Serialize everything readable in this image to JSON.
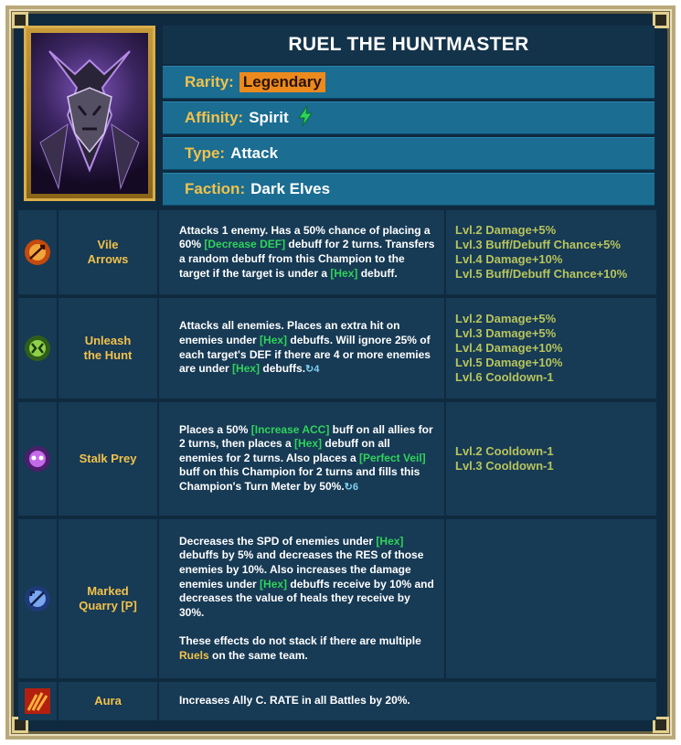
{
  "champion": {
    "name": "RUEL THE HUNTMASTER",
    "rarity_label": "Rarity:",
    "rarity": "Legendary",
    "affinity_label": "Affinity:",
    "affinity": "Spirit",
    "type_label": "Type:",
    "type": "Attack",
    "faction_label": "Faction:",
    "faction": "Dark Elves"
  },
  "skills": [
    {
      "icon": "vile-arrows-icon",
      "name_line1": "Vile",
      "name_line2": "Arrows",
      "desc": {
        "p1": "Attacks 1 enemy. Has a 50% chance of placing a 60% ",
        "k1": "[Decrease DEF]",
        "p2": " debuff for 2 turns. Transfers a random debuff from this Champion to the target if the target is under a ",
        "k2": "[Hex]",
        "p3": " debuff."
      },
      "levels": [
        "Lvl.2 Damage+5%",
        "Lvl.3 Buff/Debuff Chance+5%",
        "Lvl.4 Damage+10%",
        "Lvl.5 Buff/Debuff Chance+10%"
      ]
    },
    {
      "icon": "unleash-the-hunt-icon",
      "name_line1": "Unleash",
      "name_line2": "the Hunt",
      "desc": {
        "p1": "Attacks all enemies. Places an extra hit on enemies under ",
        "k1": "[Hex]",
        "p2": " debuffs. Will ignore 25% of each target's DEF if there are 4 or more enemies are under ",
        "k2": "[Hex]",
        "p3": " debuffs.",
        "cooldown": "4"
      },
      "levels": [
        "Lvl.2 Damage+5%",
        "Lvl.3 Damage+5%",
        "Lvl.4 Damage+10%",
        "Lvl.5 Damage+10%",
        "Lvl.6 Cooldown-1"
      ]
    },
    {
      "icon": "stalk-prey-icon",
      "name": "Stalk Prey",
      "desc": {
        "p1": "Places a 50% ",
        "k1": "[Increase ACC]",
        "p2": " buff on all allies for 2 turns, then places a ",
        "k2": "[Hex]",
        "p3": " debuff on all enemies for 2 turns. Also places a ",
        "k3": "[Perfect Veil]",
        "p4": " buff on this Champion for 2 turns and fills this Champion's Turn Meter by 50%.",
        "cooldown": "6"
      },
      "levels": [
        "Lvl.2 Cooldown-1",
        "Lvl.3 Cooldown-1"
      ]
    },
    {
      "icon": "marked-quarry-icon",
      "name_line1": "Marked",
      "name_line2": "Quarry [P]",
      "desc": {
        "p1": "Decreases the SPD of enemies under ",
        "k1": "[Hex]",
        "p2": " debuffs by 5% and decreases the RES of those enemies by 10%. Also increases the damage enemies under ",
        "k2": "[Hex]",
        "p3": " debuffs receive by 10% and decreases the value of heals they receive by 30%.",
        "p4": "These effects do not stack if there are multiple ",
        "k3": "Ruels",
        "p5": " on the same team."
      },
      "levels": []
    }
  ],
  "aura": {
    "icon": "aura-icon",
    "name": "Aura",
    "desc": "Increases Ally C. RATE in all Battles by 20%."
  },
  "colors": {
    "gold_label": "#f2c24a",
    "keyword_green": "#2fd35a",
    "level_text": "#b7c45c",
    "cell_bg": "#173a55",
    "info_bg": "#1b6d92"
  }
}
